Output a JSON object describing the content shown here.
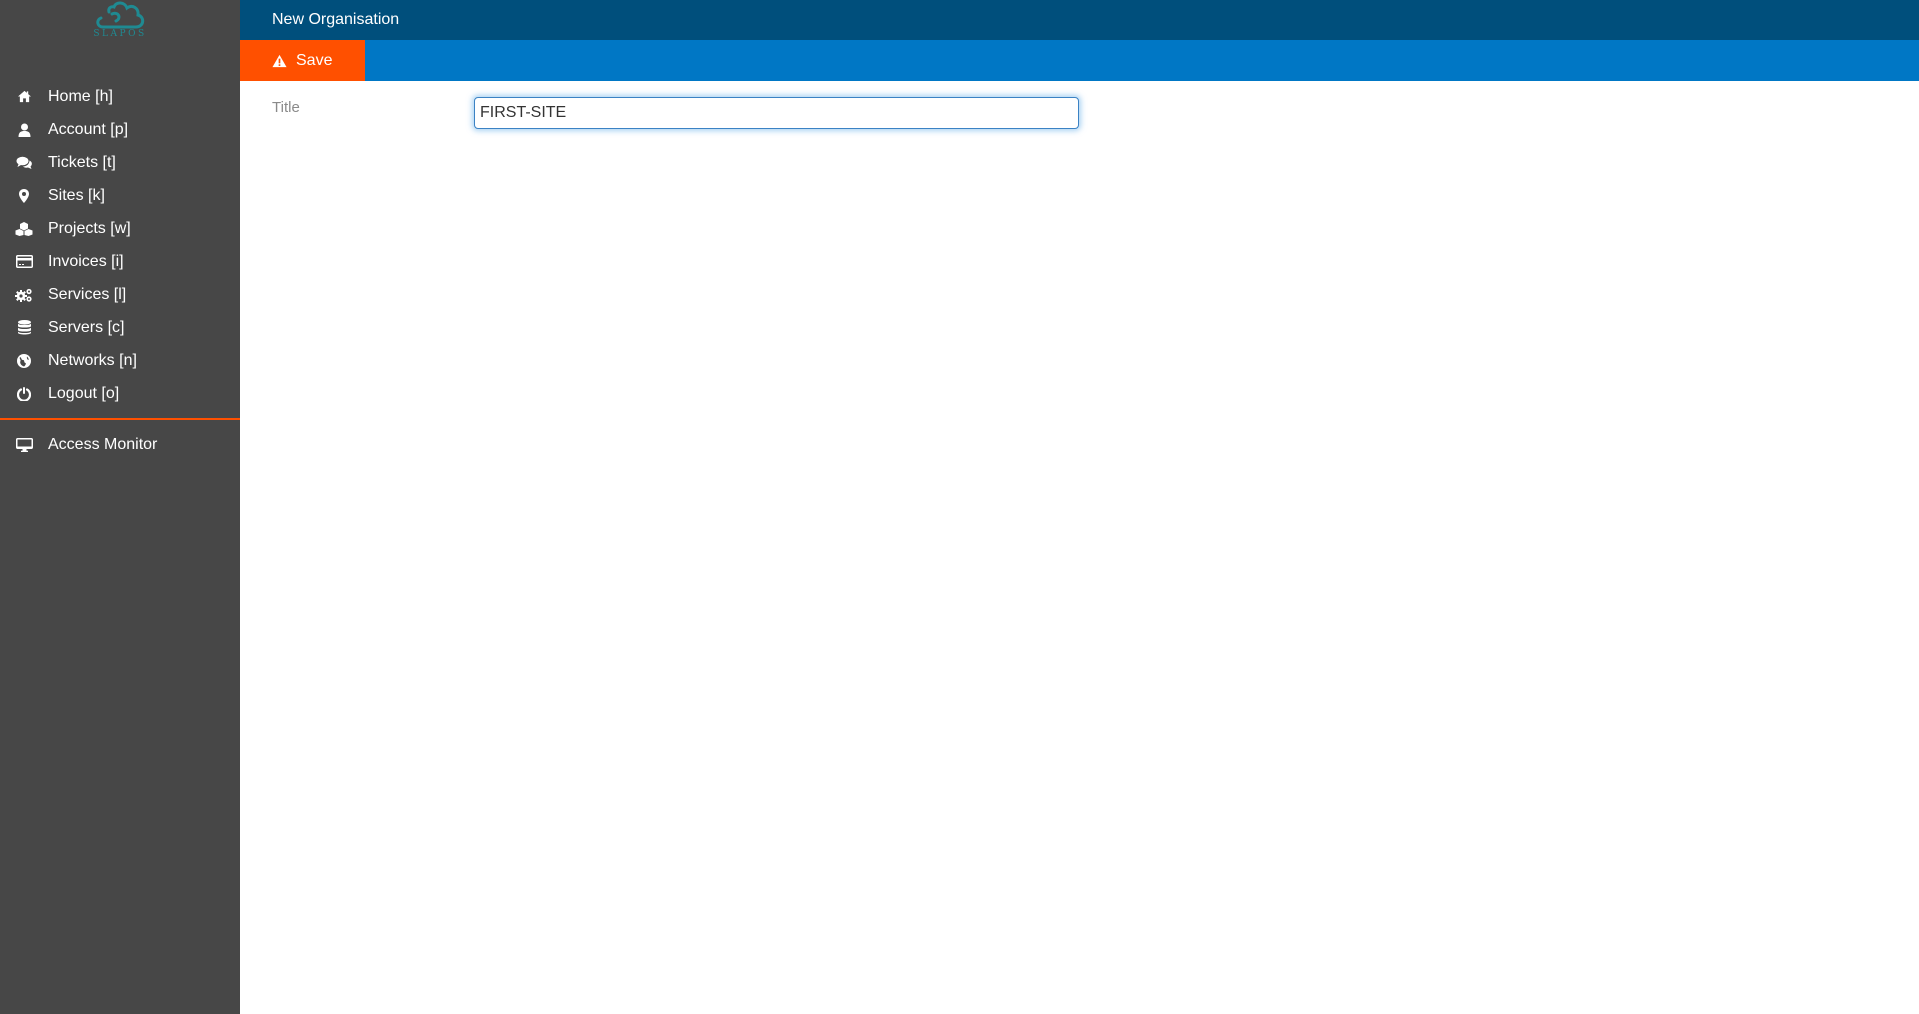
{
  "app": {
    "logo_text": "SLAPOS",
    "logo_icon": "cloud-icon",
    "brand_color": "#1f8a92"
  },
  "sidebar": {
    "items": [
      {
        "label": "Home [h]",
        "icon": "home-icon"
      },
      {
        "label": "Account [p]",
        "icon": "user-icon"
      },
      {
        "label": "Tickets [t]",
        "icon": "comments-icon"
      },
      {
        "label": "Sites [k]",
        "icon": "map-marker-icon"
      },
      {
        "label": "Projects [w]",
        "icon": "cubes-icon"
      },
      {
        "label": "Invoices [i]",
        "icon": "credit-card-icon"
      },
      {
        "label": "Services [l]",
        "icon": "gears-icon"
      },
      {
        "label": "Servers [c]",
        "icon": "database-icon"
      },
      {
        "label": "Networks [n]",
        "icon": "globe-icon"
      },
      {
        "label": "Logout [o]",
        "icon": "power-off-icon"
      }
    ],
    "secondary_items": [
      {
        "label": "Access Monitor",
        "icon": "desktop-icon"
      }
    ]
  },
  "header": {
    "title": "New Organisation"
  },
  "toolbar": {
    "save_label": "Save",
    "save_icon": "warning-icon"
  },
  "form": {
    "fields": [
      {
        "label": "Title",
        "value": "FIRST-SITE"
      }
    ]
  },
  "colors": {
    "sidebar_bg": "#474747",
    "header_bg": "#004f7c",
    "toolbar_bg": "#0077c5",
    "save_bg": "#ff5000",
    "separator": "#ff5000"
  }
}
